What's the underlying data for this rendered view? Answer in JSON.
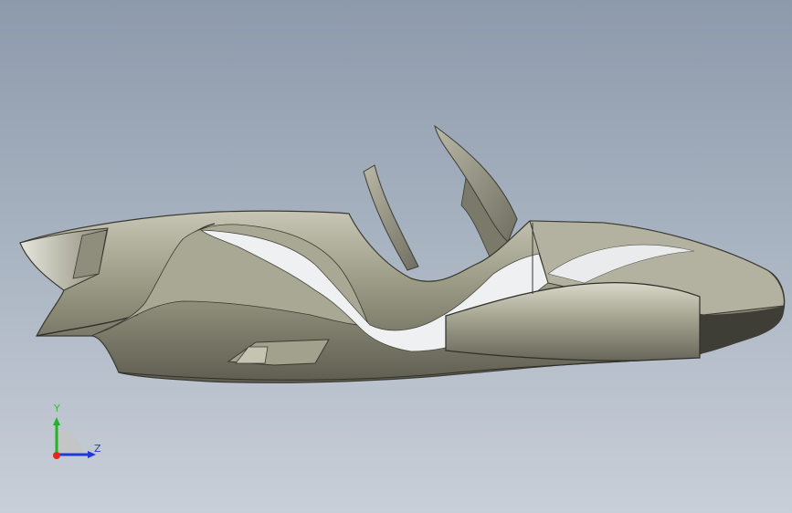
{
  "viewport": {
    "background_top": "#8d9aab",
    "background_bottom": "#c9cfd8",
    "model_color": "#9a9a86",
    "highlight_color": "#f2f4f6"
  },
  "triad": {
    "y_label": "Y",
    "z_label": "Z",
    "x_color": "#e0281e",
    "y_color": "#22b422",
    "z_color": "#1f3ad0"
  }
}
